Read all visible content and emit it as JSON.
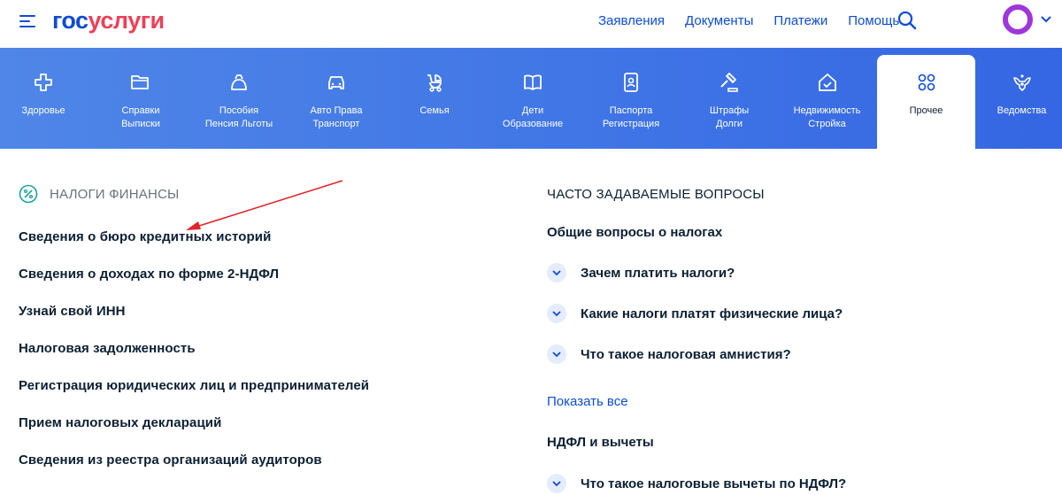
{
  "header": {
    "logo_part1": "гос",
    "logo_part2": "услуги",
    "nav": [
      "Заявления",
      "Документы",
      "Платежи",
      "Помощь"
    ]
  },
  "categories": [
    {
      "line1": "Здоровье",
      "line2": "",
      "icon": "plus-cross-icon"
    },
    {
      "line1": "Справки",
      "line2": "Выписки",
      "icon": "folder-icon"
    },
    {
      "line1": "Пособия",
      "line2": "Пенсия Льготы",
      "icon": "wallet-icon"
    },
    {
      "line1": "Авто Права",
      "line2": "Транспорт",
      "icon": "car-icon"
    },
    {
      "line1": "Семья",
      "line2": "",
      "icon": "stroller-icon"
    },
    {
      "line1": "Дети",
      "line2": "Образование",
      "icon": "book-icon"
    },
    {
      "line1": "Паспорта",
      "line2": "Регистрация",
      "icon": "passport-icon"
    },
    {
      "line1": "Штрафы",
      "line2": "Долги",
      "icon": "gavel-icon"
    },
    {
      "line1": "Недвижимость",
      "line2": "Стройка",
      "icon": "house-icon"
    },
    {
      "line1": "Прочее",
      "line2": "",
      "icon": "grid-circles-icon"
    },
    {
      "line1": "Ведомства",
      "line2": "",
      "icon": "eagle-emblem-icon"
    }
  ],
  "section": {
    "title": "НАЛОГИ ФИНАНСЫ",
    "links": [
      "Сведения о бюро кредитных историй",
      "Сведения о доходах по форме 2-НДФЛ",
      "Узнай свой ИНН",
      "Налоговая задолженность",
      "Регистрация юридических лиц и предпринимателей",
      "Прием налоговых деклараций",
      "Сведения из реестра организаций аудиторов"
    ]
  },
  "faq": {
    "title": "ЧАСТО ЗАДАВАЕМЫЕ ВОПРОСЫ",
    "group1": "Общие вопросы о налогах",
    "questions1": [
      "Зачем платить налоги?",
      "Какие налоги платят физические лица?",
      "Что такое налоговая амнистия?"
    ],
    "show_all": "Показать все",
    "group2": "НДФЛ и вычеты",
    "questions2": [
      "Что такое налоговые вычеты по НДФЛ?"
    ]
  },
  "colors": {
    "brand_blue": "#0d4cd3",
    "brand_red": "#ee3f58",
    "avatar_purple": "#9d37db",
    "arrow_red": "#e0262b"
  }
}
